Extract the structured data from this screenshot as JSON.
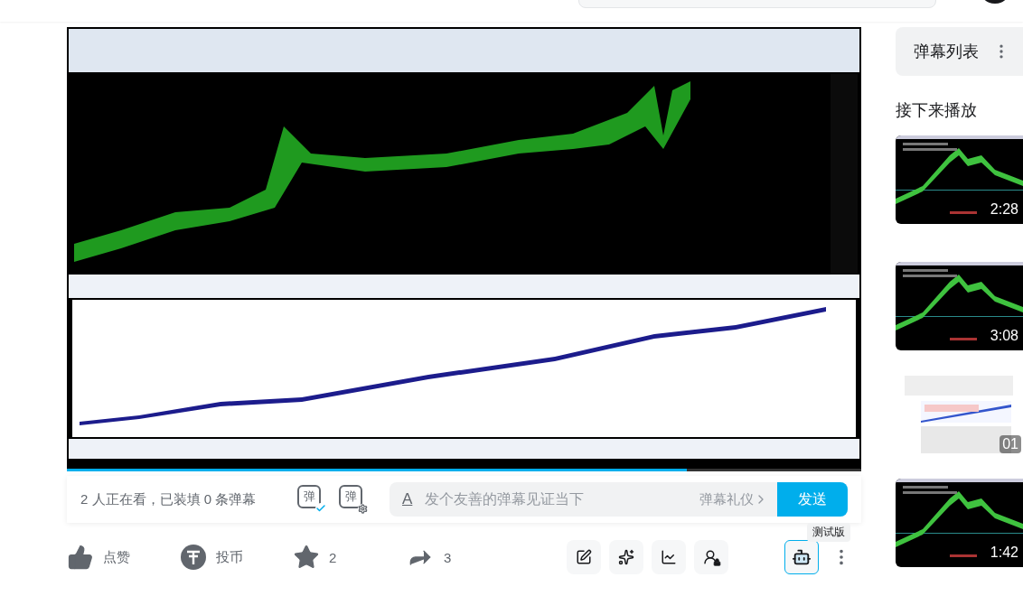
{
  "video": {
    "kind": "picture",
    "progress": {
      "level": 0.78
    }
  },
  "danmaku_bar": {
    "viewers": "2 人正在看，已装填 0 条弹幕",
    "toggle": {
      "glyph": "弹",
      "on": true
    },
    "settings_glyph": "弹",
    "input": {
      "format_glyph": "A",
      "placeholder": "发个友善的弹幕见证当下"
    },
    "etiquette": "弹幕礼仪",
    "send": "发送"
  },
  "actions": [
    {
      "kind": "like",
      "label": "点赞"
    },
    {
      "kind": "coin",
      "label": "投币"
    },
    {
      "kind": "favorite",
      "label": "2"
    },
    {
      "kind": "share",
      "label": "3"
    }
  ],
  "tools": [
    {
      "kind": "note"
    },
    {
      "kind": "pin"
    },
    {
      "kind": "chart"
    },
    {
      "kind": "lock"
    }
  ],
  "assistant": {
    "badge": "测试版"
  },
  "sidebar": {
    "danmaku_list": "弹幕列表",
    "next_title": "接下来播放",
    "videos": [
      {
        "duration": "2:28"
      },
      {
        "duration": "3:08"
      },
      {
        "duration": "01"
      },
      {
        "duration": "1:42"
      }
    ]
  }
}
